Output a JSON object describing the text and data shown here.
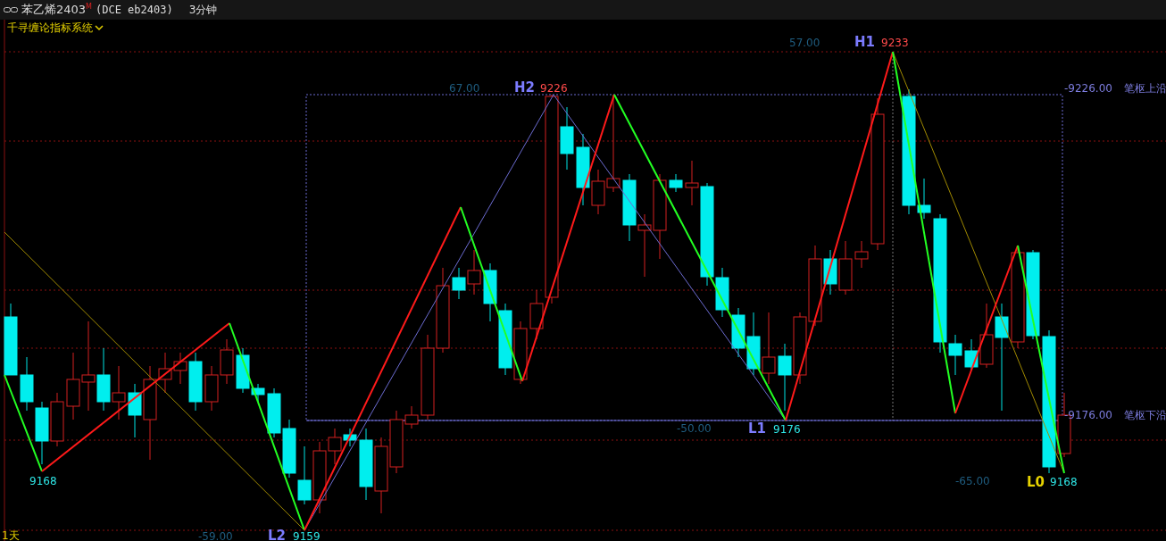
{
  "header": {
    "symbol": "苯乙烯2403",
    "flag": "M",
    "code": "(DCE eb2403)",
    "period": "3分钟"
  },
  "indicator": {
    "name": "千寻缠论指标系统"
  },
  "chart": {
    "annotations": [
      {
        "kind": "delta",
        "text": "57.00"
      },
      {
        "kind": "pivot",
        "text": "H1"
      },
      {
        "kind": "high",
        "text": "9233"
      },
      {
        "kind": "delta",
        "text": "67.00"
      },
      {
        "kind": "pivot",
        "text": "H2"
      },
      {
        "kind": "high",
        "text": "9226"
      },
      {
        "kind": "level",
        "text": "-9226.00"
      },
      {
        "kind": "level",
        "text": "笔枢上沿"
      },
      {
        "kind": "level",
        "text": "-9176.00"
      },
      {
        "kind": "level",
        "text": "笔枢下沿"
      },
      {
        "kind": "delta",
        "text": "-50.00"
      },
      {
        "kind": "pivot",
        "text": "L1"
      },
      {
        "kind": "low",
        "text": "9176"
      },
      {
        "kind": "low",
        "text": "9168"
      },
      {
        "kind": "delta",
        "text": "-65.00"
      },
      {
        "kind": "pivot-current",
        "text": "L0"
      },
      {
        "kind": "low",
        "text": "9168"
      },
      {
        "kind": "period",
        "text": "1天"
      },
      {
        "kind": "delta",
        "text": "-59.00"
      },
      {
        "kind": "pivot",
        "text": "L2"
      },
      {
        "kind": "low",
        "text": "9159"
      }
    ]
  }
}
